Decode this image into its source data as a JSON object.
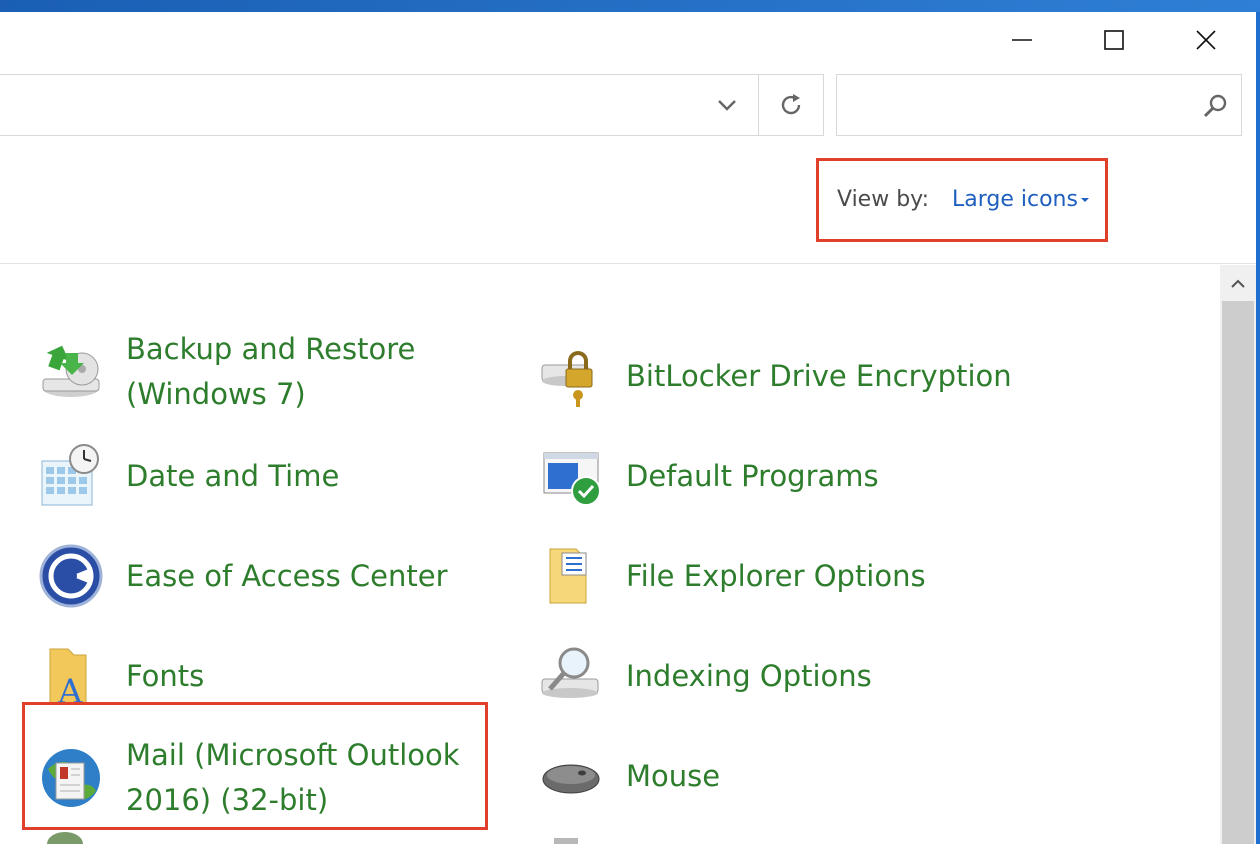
{
  "window": {
    "caption_buttons": [
      "minimize",
      "maximize",
      "close"
    ]
  },
  "address_bar": {
    "value": ""
  },
  "search": {
    "placeholder": ""
  },
  "view_by": {
    "label": "View by:",
    "value": "Large icons"
  },
  "items": [
    {
      "label_line1": "Backup and Restore",
      "label_line2": "(Windows 7)",
      "icon": "backup-restore-icon"
    },
    {
      "label": "BitLocker Drive Encryption",
      "icon": "bitlocker-icon"
    },
    {
      "label": "Date and Time",
      "icon": "date-time-icon"
    },
    {
      "label": "Default Programs",
      "icon": "default-programs-icon"
    },
    {
      "label": "Ease of Access Center",
      "icon": "ease-of-access-icon"
    },
    {
      "label": "File Explorer Options",
      "icon": "file-explorer-options-icon"
    },
    {
      "label": "Fonts",
      "icon": "fonts-icon"
    },
    {
      "label": "Indexing Options",
      "icon": "indexing-options-icon"
    },
    {
      "label_line1": "Mail (Microsoft Outlook",
      "label_line2": "2016) (32-bit)",
      "icon": "mail-icon"
    },
    {
      "label": "Mouse",
      "icon": "mouse-icon"
    }
  ],
  "colors": {
    "link_green": "#2d7d2d",
    "accent_blue": "#1f5fbf",
    "highlight_red": "#e0402a",
    "window_border": "#1f6fd0"
  }
}
